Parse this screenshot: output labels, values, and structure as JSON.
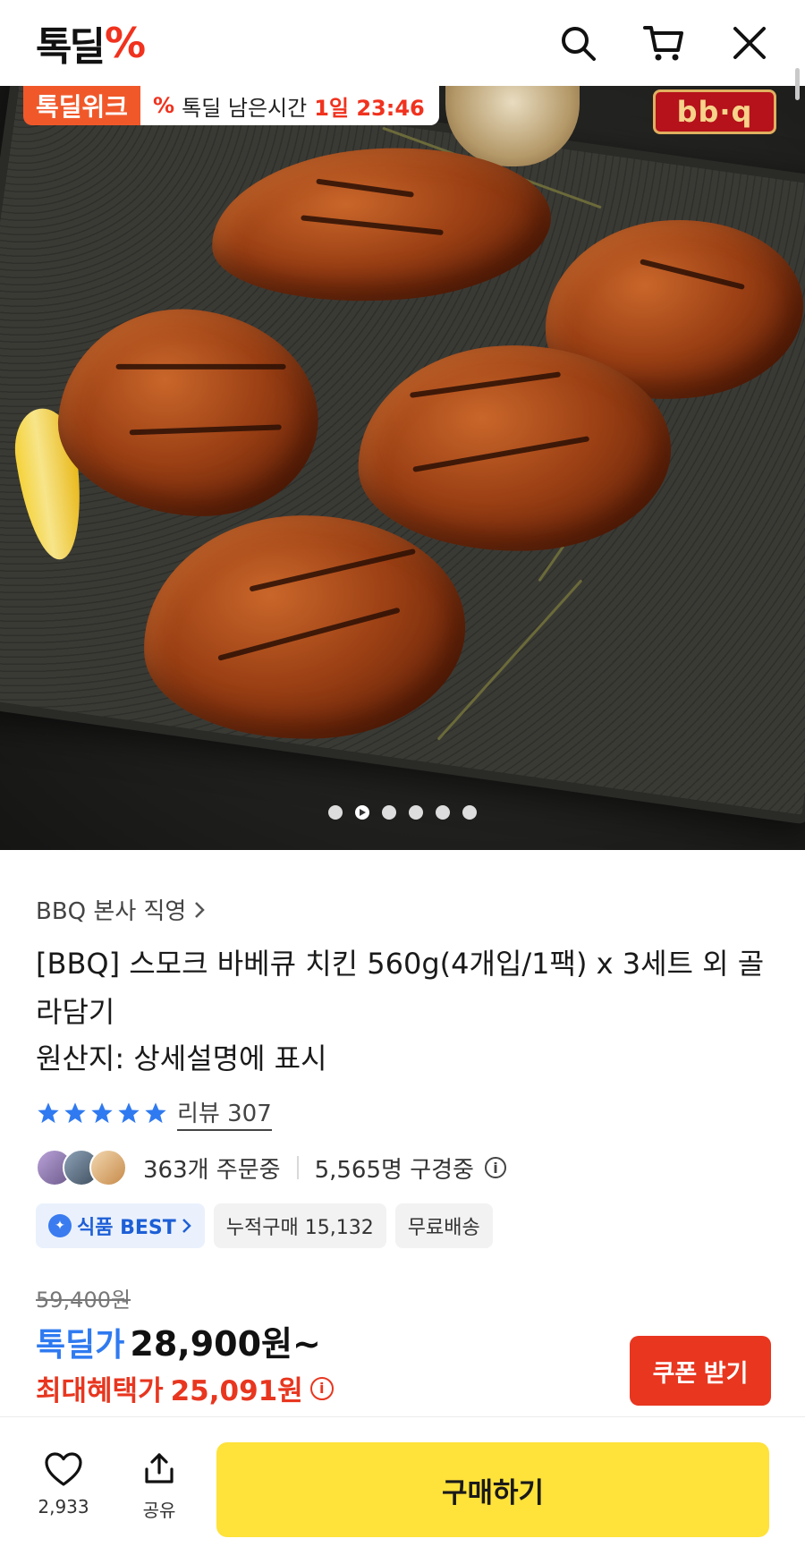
{
  "header": {
    "logo_text": "톡딜",
    "logo_accent": "%",
    "icons": [
      "search-icon",
      "cart-icon",
      "close-icon"
    ]
  },
  "hero": {
    "promo_tag": "톡딜위크",
    "promo_pct": "%",
    "promo_label": "톡딜 남은시간",
    "countdown": "1일 23:46",
    "brand_logo": "bb·q",
    "slide_dots": 6,
    "active_slide": 2
  },
  "product": {
    "seller": "BBQ 본사 직영",
    "title": "[BBQ] 스모크 바베큐 치킨 560g(4개입/1팩) x 3세트 외 골라담기",
    "origin": "원산지: 상세설명에 표시",
    "rating_stars": 5,
    "review_link": "리뷰 307",
    "orders": "363개 주문중",
    "viewers": "5,565명 구경중",
    "badges": {
      "best": "식품 BEST",
      "cumulative": "누적구매 15,132",
      "shipping": "무료배송"
    }
  },
  "price": {
    "original": "59,400원",
    "deal_label": "톡딜가",
    "deal_price": "28,900원~",
    "max_label": "최대혜택가",
    "max_price": "25,091원",
    "coupon_button": "쿠폰 받기"
  },
  "bottom_bar": {
    "wish_count": "2,933",
    "share_label": "공유",
    "buy_button": "구매하기"
  },
  "colors": {
    "brand_red": "#f0321e",
    "deal_blue": "#2f7af0",
    "benefit_red": "#e8361f",
    "buy_yellow": "#ffe23a",
    "star_blue": "#2f7af0"
  }
}
